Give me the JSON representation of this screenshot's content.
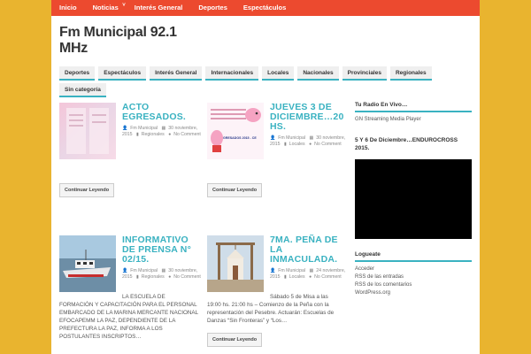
{
  "topnav": {
    "items": [
      "Inicio",
      "Noticias",
      "Interés General",
      "Deportes",
      "Espectáculos"
    ],
    "dropdown_caret": "˅"
  },
  "site": {
    "title": "Fm Municipal 92.1 MHz"
  },
  "categories": {
    "row1": [
      "Deportes",
      "Espectáculos",
      "Interés General",
      "Internacionales",
      "Locales",
      "Nacionales",
      "Provinciales",
      "Regionales"
    ],
    "row2": [
      "Sin categoría"
    ]
  },
  "posts": [
    {
      "title": "ACTO EGRESADOS.",
      "author": "Fm Municipal",
      "date": "30 noviembre, 2015",
      "category": "Regionales",
      "comments": "No Comment",
      "excerpt": "",
      "button": "Continuar Leyendo"
    },
    {
      "title": "JUEVES 3 DE DICIEMBRE…20 HS.",
      "author": "Fm Municipal",
      "date": "30 noviembre, 2015",
      "category": "Locales",
      "comments": "No Comment",
      "excerpt": "",
      "button": "Continuar Leyendo",
      "thumb_text": "GRESADOS 2015 - CE"
    },
    {
      "title": "INFORMATIVO DE PRENSA N° 02/15.",
      "author": "Fm Municipal",
      "date": "30 noviembre, 2015",
      "category": "Regionales",
      "comments": "No Comment",
      "excerpt_indent": "LA ESCUELA DE",
      "excerpt": "FORMACIÓN Y CAPACITACIÓN PARA EL PERSONAL EMBARCADO DE LA MARINA MERCANTE NACIONAL EFOCAPEMM LA PAZ, DEPENDIENTE DE LA PREFECTURA LA PAZ, INFORMA A LOS POSTULANTES INSCRIPTOS…",
      "button": "Continuar Leyendo"
    },
    {
      "title": "7MA. PEÑA DE LA INMACULADA.",
      "author": "Fm Municipal",
      "date": "24 noviembre, 2015",
      "category": "Locales",
      "comments": "No Comment",
      "excerpt_indent": "Sábado 5 de Misa a las",
      "excerpt": "19:00 hs. 21:00 hs – Comienzo de la Peña con la representación del Pesebre. Actuarán: Escuelas de Danzas “Sin Fronteras” y “Los…",
      "button": "Continuar Leyendo"
    }
  ],
  "sidebar": {
    "radio_title": "Tu Radio En Vivo…",
    "radio_text": "GN Streaming Media Player",
    "event_title": "5 Y 6 De Diciembre…ENDUROCROSS 2015.",
    "login_title": "Logueate",
    "links": [
      "Acceder",
      "RSS de las entradas",
      "RSS de los comentarios",
      "WordPress.org"
    ]
  },
  "colors": {
    "accent": "#3ab2c1",
    "topbar": "#ec4a2f",
    "background": "#e9b42f"
  },
  "icons": {
    "author": "user-icon",
    "date": "calendar-icon",
    "category": "folder-icon",
    "comments": "comment-icon"
  }
}
